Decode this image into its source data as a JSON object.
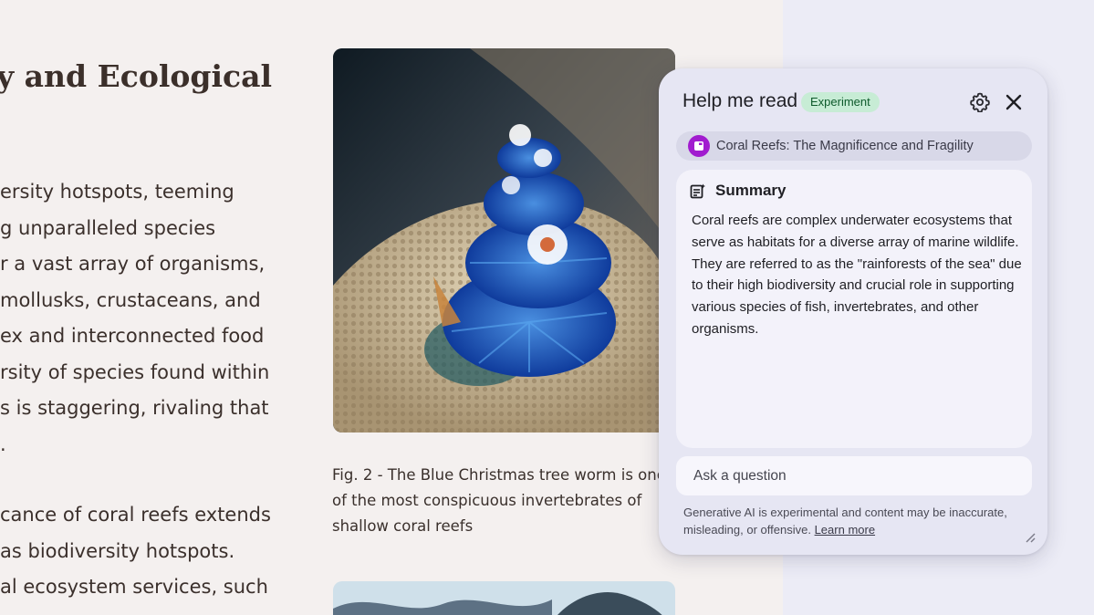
{
  "article": {
    "heading": "y and Ecological",
    "paragraph1": [
      "ersity hotspots, teeming",
      "g unparalleled species",
      "r a vast array of organisms,",
      "mollusks, crustaceans, and",
      "ex and interconnected food",
      "rsity of species found within",
      "s is staggering, rivaling that",
      "."
    ],
    "paragraph2": [
      "cance of coral reefs extends",
      "as biodiversity hotspots.",
      "al ecosystem services, such"
    ],
    "figure_caption": "Fig. 2 - The Blue Christmas tree worm is one of the most conspicuous invertebrates of shallow coral reefs"
  },
  "panel": {
    "title": "Help me read",
    "badge": "Experiment",
    "settings_icon": "gear-icon",
    "close_icon": "close-icon",
    "source_title": "Coral Reefs: The Magnificence and Fragility",
    "summary_title": "Summary",
    "summary_text": "Coral reefs are complex underwater ecosystems that serve as habitats for a diverse array of marine wildlife. They are referred to as the \"rainforests of the sea\" due to their high biodiversity and crucial role in supporting various species of fish, invertebrates, and other organisms.",
    "ask_placeholder": "Ask a question",
    "disclaimer": "Generative AI is experimental and content may be inaccurate, misleading, or offensive.",
    "learn_more": "Learn more"
  },
  "colors": {
    "accent_badge": "#c7ecd5",
    "source_icon": "#a11ccf",
    "panel_bg": "#e6e6f3",
    "article_bg": "#f4f0ef"
  }
}
